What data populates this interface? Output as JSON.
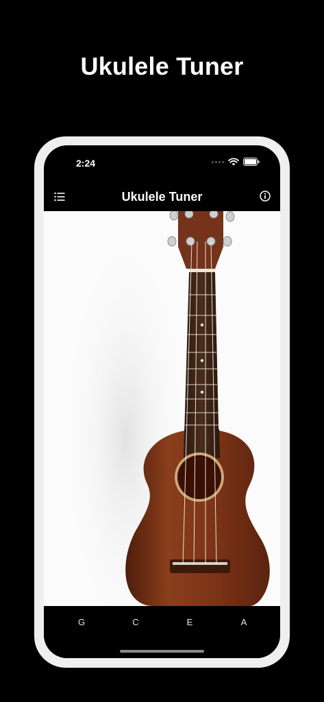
{
  "promo": {
    "headline": "Ukulele Tuner"
  },
  "status_bar": {
    "time": "2:24"
  },
  "nav": {
    "title": "Ukulele Tuner",
    "menu_icon": "list-icon",
    "info_icon": "info-icon"
  },
  "tabs": [
    {
      "label": "G"
    },
    {
      "label": "C"
    },
    {
      "label": "E"
    },
    {
      "label": "A"
    }
  ],
  "colors": {
    "background": "#000000",
    "frame": "#efefef",
    "ukulele_wood": "#7a3518"
  }
}
